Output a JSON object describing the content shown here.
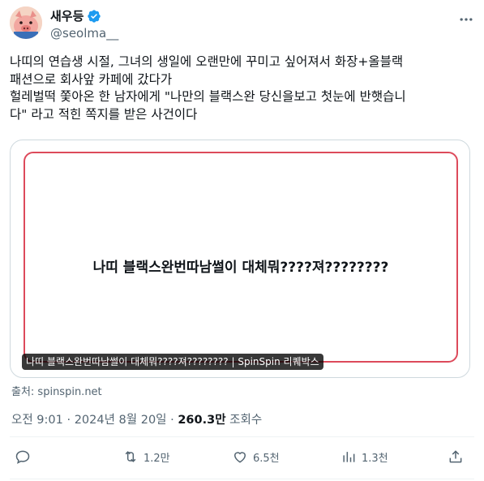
{
  "author": {
    "display_name": "새우등",
    "handle": "@seolma__",
    "verified": true,
    "avatar_icon": "pig-avatar"
  },
  "tweet": {
    "text_lines": [
      "나띠의 연습생 시절, 그녀의 생일에 오랜만에 꾸미고 싶어져서 화장+올블랙",
      "패션으로 회사앞 카페에 갔다가",
      "헐레벌떡 쫓아온 한 남자에게 \"나만의 블랙스완 당신을보고 첫눈에 반햇습니",
      "다\" 라고 적힌 쪽지를 받은 사건이다"
    ]
  },
  "card": {
    "headline": "나띠 블랙스완번따남썰이 대체뭐????져????????",
    "caption": "나띠 블랙스완번따남썰이 대체뭐????져???????? | SpinSpin 리퀘박스",
    "source_label": "출처: spinspin.net",
    "accent_color": "#dd4a5b"
  },
  "meta": {
    "time": "오전 9:01",
    "separator": "·",
    "date": "2024년 8월 20일",
    "views_count": "260.3만",
    "views_label": "조회수"
  },
  "actions": {
    "reply": {
      "icon": "reply-icon",
      "count": ""
    },
    "retweet": {
      "icon": "retweet-icon",
      "count": "1.2만"
    },
    "like": {
      "icon": "heart-icon",
      "count": "6.5천"
    },
    "bookmark": {
      "icon": "bookmark-icon",
      "count": "1.3천"
    },
    "share": {
      "icon": "share-icon",
      "count": ""
    }
  },
  "colors": {
    "text": "#0f1419",
    "secondary": "#536471",
    "verified": "#1d9bf0",
    "border": "#cfd9de"
  }
}
